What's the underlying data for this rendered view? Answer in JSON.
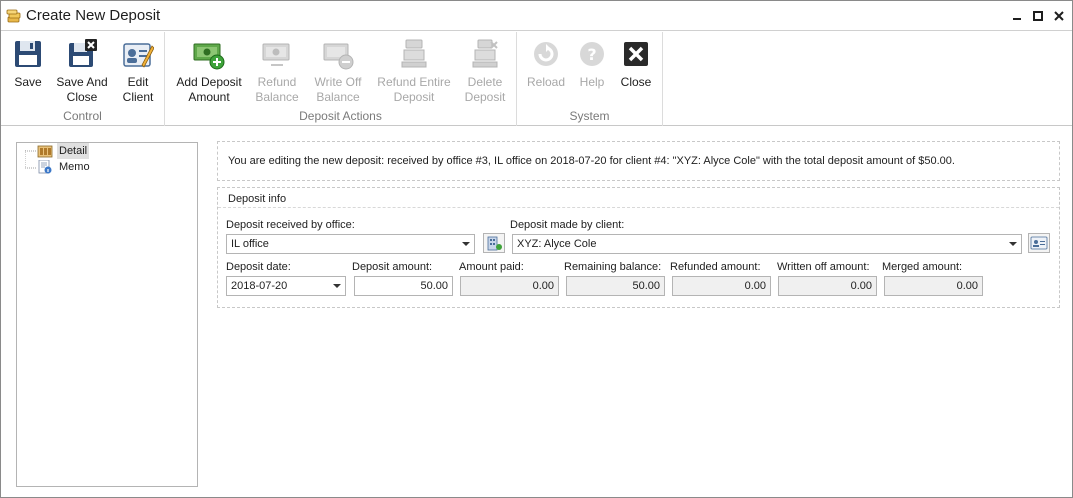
{
  "window": {
    "title": "Create New Deposit"
  },
  "ribbon": {
    "groups": [
      {
        "label": "Control",
        "buttons": [
          {
            "label": "Save",
            "icon": "floppy-disk-icon",
            "enabled": true
          },
          {
            "label": "Save And\nClose",
            "icon": "floppy-disk-close-icon",
            "enabled": true
          },
          {
            "label": "Edit\nClient",
            "icon": "edit-client-icon",
            "enabled": true
          }
        ]
      },
      {
        "label": "Deposit Actions",
        "buttons": [
          {
            "label": "Add Deposit\nAmount",
            "icon": "add-money-icon",
            "enabled": true
          },
          {
            "label": "Refund\nBalance",
            "icon": "refund-balance-icon",
            "enabled": false
          },
          {
            "label": "Write Off\nBalance",
            "icon": "write-off-icon",
            "enabled": false
          },
          {
            "label": "Refund Entire\nDeposit",
            "icon": "refund-deposit-icon",
            "enabled": false
          },
          {
            "label": "Delete\nDeposit",
            "icon": "delete-deposit-icon",
            "enabled": false
          }
        ]
      },
      {
        "label": "System",
        "buttons": [
          {
            "label": "Reload",
            "icon": "reload-icon",
            "enabled": false
          },
          {
            "label": "Help",
            "icon": "help-icon",
            "enabled": false
          },
          {
            "label": "Close",
            "icon": "close-icon",
            "enabled": true
          }
        ]
      }
    ]
  },
  "tree": {
    "items": [
      {
        "label": "Detail",
        "icon": "detail-icon",
        "selected": true
      },
      {
        "label": "Memo",
        "icon": "memo-icon",
        "selected": false
      }
    ]
  },
  "info": {
    "text": "You are editing the new deposit: received by office #3, IL office on 2018-07-20 for client #4: \"XYZ: Alyce Cole\" with the total deposit amount of $50.00."
  },
  "deposit_info": {
    "title": "Deposit info",
    "office_label": "Deposit received by office:",
    "office_value": "IL office",
    "client_label": "Deposit made by client:",
    "client_value": "XYZ: Alyce Cole",
    "date_label": "Deposit date:",
    "date_value": "2018-07-20",
    "amount_label": "Deposit amount:",
    "amount_value": "50.00",
    "paid_label": "Amount paid:",
    "paid_value": "0.00",
    "remaining_label": "Remaining balance:",
    "remaining_value": "50.00",
    "refunded_label": "Refunded amount:",
    "refunded_value": "0.00",
    "written_off_label": "Written off amount:",
    "written_off_value": "0.00",
    "merged_label": "Merged amount:",
    "merged_value": "0.00"
  },
  "colors": {
    "disabled_text": "#a8a8a8",
    "group_label": "#7a7a7a",
    "readonly_bg": "#f0f0f0"
  }
}
